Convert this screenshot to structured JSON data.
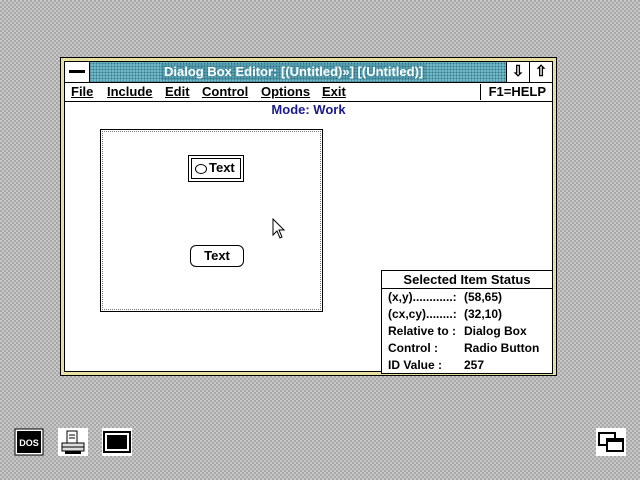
{
  "window": {
    "title": "Dialog Box Editor: [(Untitled)»] [(Untitled)]",
    "minimize_icon": "down-arrow-icon",
    "maximize_icon": "up-arrow-icon"
  },
  "menu": {
    "items": [
      {
        "label": "File"
      },
      {
        "label": "Include"
      },
      {
        "label": "Edit"
      },
      {
        "label": "Control"
      },
      {
        "label": "Options"
      },
      {
        "label": "Exit"
      }
    ],
    "help": "F1=HELP"
  },
  "mode_text": "Mode: Work",
  "dialog": {
    "radio_label": "Text",
    "button_label": "Text"
  },
  "status_panel": {
    "title": "Selected Item Status",
    "rows": [
      {
        "key": "(x,y)............:",
        "value": "(58,65)"
      },
      {
        "key": "(cx,cy)........:",
        "value": "(32,10)"
      },
      {
        "key": "Relative to :",
        "value": "Dialog Box"
      },
      {
        "key": "Control      :",
        "value": "Radio Button"
      },
      {
        "key": "ID Value    :",
        "value": "257"
      }
    ]
  },
  "desktop": {
    "icons": [
      {
        "name": "dos-icon",
        "label": "DOS"
      },
      {
        "name": "printer-icon"
      },
      {
        "name": "monitor-icon"
      },
      {
        "name": "window-switch-icon"
      }
    ]
  },
  "colors": {
    "titlebar": "#70b8c8",
    "window_frame": "#e8e0a0",
    "mode_text": "#1a1a8c"
  }
}
